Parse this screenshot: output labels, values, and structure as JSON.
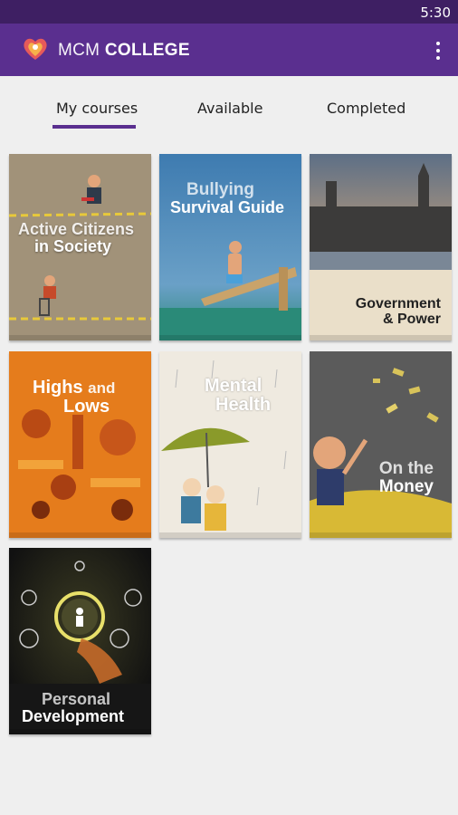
{
  "status_bar": {
    "time": "5:30"
  },
  "app_bar": {
    "title_light": "MCM",
    "title_bold": "COLLEGE"
  },
  "tabs": [
    {
      "label": "My courses",
      "selected": true
    },
    {
      "label": "Available",
      "selected": false
    },
    {
      "label": "Completed",
      "selected": false
    }
  ],
  "colors": {
    "primary": "#5a2f8f",
    "status_bar": "#3e1f63",
    "background": "#efefef"
  },
  "courses": [
    {
      "line1": "Active Citizens",
      "line2": "in Society"
    },
    {
      "line1": "Bullying",
      "line2": "Survival Guide"
    },
    {
      "line1": "Government",
      "line2": "& Power"
    },
    {
      "line1": "Highs",
      "line1b": "and",
      "line2": "Lows"
    },
    {
      "line1": "Mental",
      "line2": "Health"
    },
    {
      "line1": "On the",
      "line2": "Money"
    },
    {
      "line1": "Personal",
      "line2": "Development"
    }
  ]
}
